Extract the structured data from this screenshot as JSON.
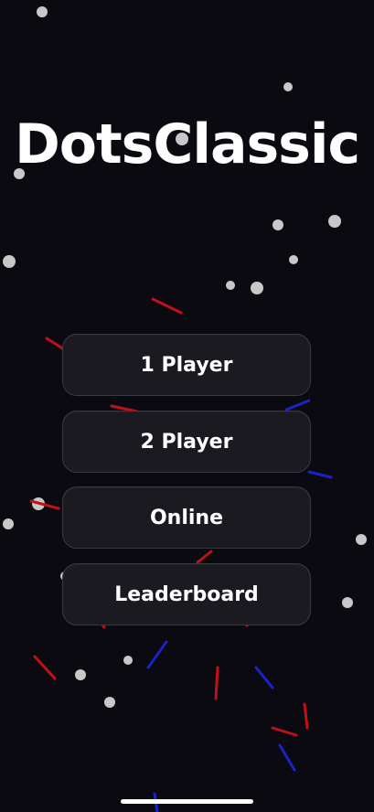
{
  "app": {
    "title": "DotsClassic"
  },
  "menu": {
    "buttons": [
      {
        "label": "1 Player"
      },
      {
        "label": "2 Player"
      },
      {
        "label": "Online"
      },
      {
        "label": "Leaderboard"
      }
    ]
  },
  "colors": {
    "background": "#0b0a10",
    "button_bg": "#1b1a20",
    "button_border": "#3a3940",
    "dot": "#c8c8c8",
    "line_red": "#c0101a",
    "line_blue": "#1a22c8",
    "text": "#ffffff"
  }
}
